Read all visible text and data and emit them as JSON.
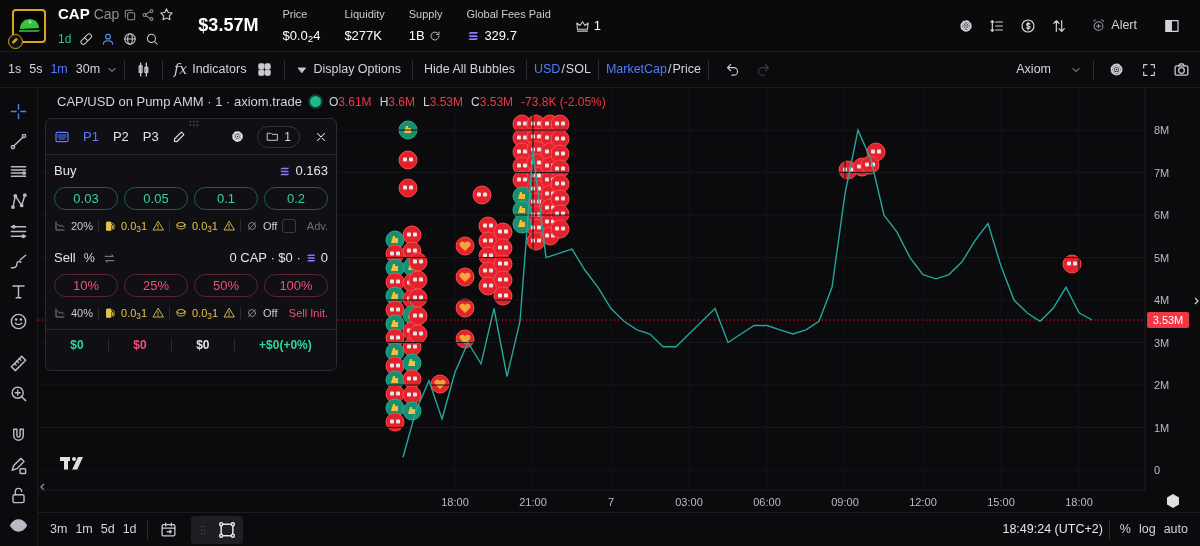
{
  "header": {
    "symbol": "CAP",
    "name": "Cap",
    "age": "1d",
    "market_cap": "$3.57M",
    "stats": [
      {
        "label": "Price",
        "value": "$0.0$_{2}$4",
        "kind": "plain"
      },
      {
        "label": "Liquidity",
        "value": "$277K",
        "kind": "plain"
      },
      {
        "label": "Supply",
        "value": "1B",
        "kind": "refresh"
      },
      {
        "label": "Global Fees Paid",
        "value": "329.7",
        "kind": "sol"
      }
    ],
    "holders": "1",
    "alert_label": "Alert"
  },
  "toolbar": {
    "timeframes": [
      {
        "label": "1s",
        "selected": false
      },
      {
        "label": "5s",
        "selected": false
      },
      {
        "label": "1m",
        "selected": true
      },
      {
        "label": "30m",
        "selected": false
      }
    ],
    "indicators": {
      "icon": "fx",
      "label": "Indicators"
    },
    "display_options": "Display Options",
    "hide_bubbles": "Hide All Bubbles",
    "currency_toggle": {
      "separator": "/",
      "options": [
        {
          "label": "USD",
          "selected": true
        },
        {
          "label": "SOL",
          "selected": false
        }
      ]
    },
    "value_toggle": {
      "separator": "/",
      "options": [
        {
          "label": "MarketCap",
          "selected": true
        },
        {
          "label": "Price",
          "selected": false
        }
      ]
    },
    "redo_disabled": true,
    "source": "Axiom"
  },
  "legend": {
    "title": "CAP/USD on Pump AMM · 1 · axiom.trade",
    "ohlc": [
      {
        "key": "O",
        "value": "3.61M"
      },
      {
        "key": "H",
        "value": "3.6M"
      },
      {
        "key": "L",
        "value": "3.53M"
      },
      {
        "key": "C",
        "value": "3.53M"
      }
    ],
    "change": "-73.8K (-2.05%)"
  },
  "trade_panel": {
    "presets": [
      {
        "label": "P1",
        "selected": true
      },
      {
        "label": "P2",
        "selected": false
      },
      {
        "label": "P3",
        "selected": false
      }
    ],
    "wallet_count": "1",
    "buy": {
      "label": "Buy",
      "balance": "0.163",
      "amounts": [
        "0.03",
        "0.05",
        "0.1",
        "0.2"
      ],
      "slippage": "20%",
      "priority_fee": "0.0$_{3}$1",
      "bribe": "0.0$_{3}$1",
      "mev": "Off",
      "advanced": {
        "label": "Adv.",
        "checked": false
      }
    },
    "sell": {
      "label": "Sell",
      "unit": "%",
      "holdings": "0 CAP · $0 ·",
      "sol_amount": "0",
      "amounts": [
        "10%",
        "25%",
        "50%",
        "100%"
      ],
      "slippage": "40%",
      "priority_fee": "0.0$_{3}$1",
      "bribe": "0.0$_{3}$1",
      "mev": "Off",
      "init_label": "Sell Init."
    },
    "totals": [
      {
        "value": "$0",
        "color": "#2fd69b"
      },
      {
        "value": "$0",
        "color": "#f0507a"
      },
      {
        "value": "$0",
        "color": "#e3e5ea"
      },
      {
        "value": "+$0(+0%)",
        "color": "#2fd69b"
      }
    ]
  },
  "chart": {
    "last_price": "3.53M",
    "chart_data": {
      "type": "line",
      "grid": true,
      "categories": [
        null,
        null,
        null,
        null,
        "18:00",
        null,
        null,
        null,
        null,
        null,
        "21:00",
        null,
        null,
        null,
        null,
        null,
        "7",
        null,
        null,
        null,
        null,
        null,
        "03:00",
        null,
        null,
        null,
        null,
        null,
        "06:00",
        null,
        null,
        null,
        null,
        null,
        "09:00",
        null,
        null,
        null,
        null,
        null,
        "12:00",
        null,
        null,
        null,
        null,
        null,
        "15:00",
        null,
        null,
        null,
        null,
        null,
        "18:00",
        null
      ],
      "series": [
        {
          "color": "#26a69a",
          "values": [
            0.3,
            1.4,
            2.1,
            1.2,
            2.3,
            3.0,
            2.5,
            3.8,
            2.2,
            3.5,
            7.5,
            5.0,
            5.1,
            5.2,
            4.7,
            4.3,
            3.8,
            3.5,
            3.3,
            3.2,
            2.9,
            2.9,
            3.2,
            3.5,
            3.8,
            3.0,
            3.2,
            3.4,
            3.4,
            3.3,
            3.2,
            3.3,
            3.5,
            4.3,
            6.5,
            8.0,
            7.3,
            6.0,
            5.6,
            5.0,
            4.6,
            4.5,
            4.6,
            4.9,
            5.4,
            5.8,
            4.8,
            4.0,
            3.7,
            3.5,
            3.8,
            4.3,
            3.7,
            3.53
          ]
        }
      ],
      "ylim": [
        -0.47,
        8.99
      ],
      "yticks": [
        {
          "value": 0,
          "label": "0"
        },
        {
          "value": 1,
          "label": "1M"
        },
        {
          "value": 2,
          "label": "2M"
        },
        {
          "value": 3,
          "label": "3M"
        },
        {
          "value": 4,
          "label": "4M"
        },
        {
          "value": 5,
          "label": "5M"
        },
        {
          "value": 6,
          "label": "6M"
        },
        {
          "value": 7,
          "label": "7M"
        },
        {
          "value": 8,
          "label": "8M"
        }
      ]
    }
  },
  "bottom_bar": {
    "ranges": [
      "3m",
      "1m",
      "5d",
      "1d"
    ],
    "clock": "18:49:24 (UTC+2)",
    "scale_options": [
      "%",
      "log",
      "auto"
    ]
  }
}
